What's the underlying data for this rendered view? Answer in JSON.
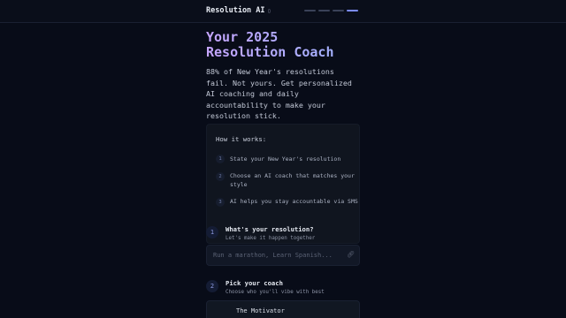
{
  "header": {
    "brand": "Resolution AI",
    "brand_icon": "sparkle-icon",
    "progress_steps": 4,
    "progress_active_index": 3
  },
  "hero": {
    "title_line1": "Your 2025",
    "title_line2": "Resolution Coach",
    "subtitle": "88% of New Year's resolutions fail. Not yours. Get personalized AI coaching and daily accountability to make your resolution stick."
  },
  "how_it_works": {
    "title": "How it works:",
    "steps": [
      {
        "num": "1",
        "text": "State your New Year's resolution"
      },
      {
        "num": "2",
        "text": "Choose an AI coach that matches your style"
      },
      {
        "num": "3",
        "text": "AI helps you stay accountable via SMS"
      }
    ]
  },
  "resolution_section": {
    "num": "1",
    "title": "What's your resolution?",
    "subtitle": "Let's make it happen together",
    "input_placeholder": "Run a marathon, Learn Spanish...",
    "input_value": ""
  },
  "coach_section": {
    "num": "2",
    "title": "Pick your coach",
    "subtitle": "Choose who you'll vibe with best",
    "coaches": [
      {
        "name": "The Motivator"
      }
    ]
  },
  "colors": {
    "background": "#080c18",
    "accent": "#7c8cff",
    "title_gradient_start": "#c6a6ff",
    "title_gradient_end": "#9db2ff"
  }
}
